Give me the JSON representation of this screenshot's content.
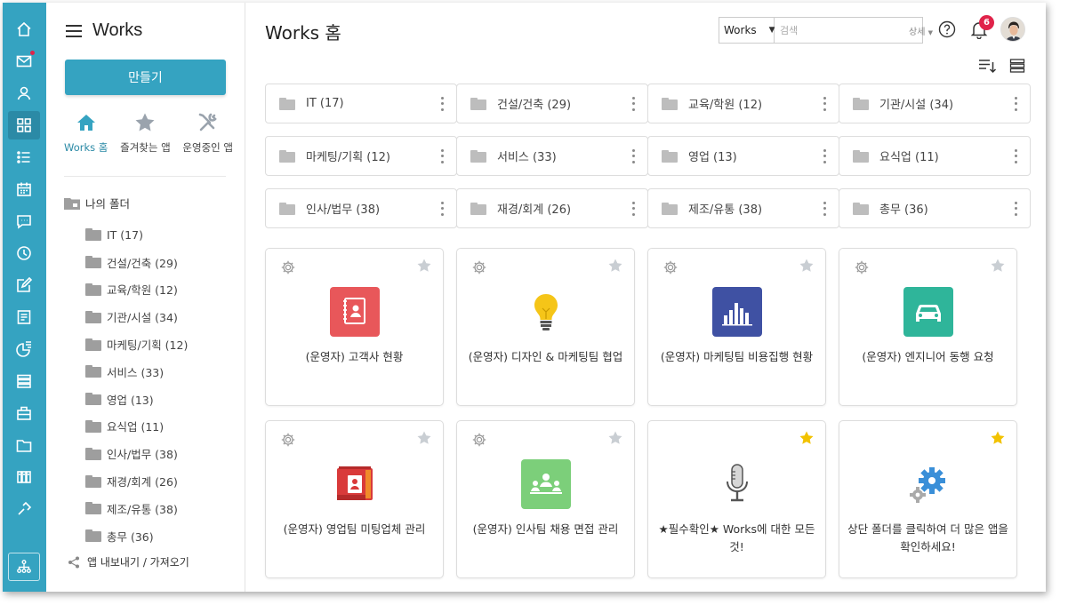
{
  "sidebar": {
    "title": "Works",
    "create_label": "만들기",
    "tabs": [
      {
        "label": "Works 홈",
        "icon": "home-icon"
      },
      {
        "label": "즐겨찾는 앱",
        "icon": "star-icon"
      },
      {
        "label": "운영중인 앱",
        "icon": "tools-icon"
      }
    ],
    "my_folder_label": "나의 폴더",
    "folders": [
      "IT (17)",
      "건설/건축 (29)",
      "교육/학원 (12)",
      "기관/시설 (34)",
      "마케팅/기획 (12)",
      "서비스 (33)",
      "영업 (13)",
      "요식업 (11)",
      "인사/법무 (38)",
      "재경/회계 (26)",
      "제조/유통 (38)",
      "총무 (36)"
    ],
    "export_label": "앱 내보내기 / 가져오기"
  },
  "header": {
    "title": "Works 홈",
    "search_scope": "Works",
    "search_placeholder": "검색",
    "search_detail": "상세",
    "notification_count": "6"
  },
  "folder_cards": [
    "IT (17)",
    "건설/건축 (29)",
    "교육/학원 (12)",
    "기관/시설 (34)",
    "마케팅/기획 (12)",
    "서비스 (33)",
    "영업 (13)",
    "요식업 (11)",
    "인사/법무 (38)",
    "재경/회계 (26)",
    "제조/유통 (38)",
    "총무 (36)"
  ],
  "apps": [
    {
      "label": "(운영자) 고객사 현황",
      "icon": "contact-book-icon",
      "color": "#e8575a",
      "starred": false
    },
    {
      "label": "(운영자) 디자인 & 마케팅팀 협업",
      "icon": "lightbulb-icon",
      "color": "#f5c518",
      "starred": false
    },
    {
      "label": "(운영자) 마케팅팀 비용집행 현황",
      "icon": "bar-chart-icon",
      "color": "#3f51a3",
      "starred": false
    },
    {
      "label": "(운영자) 엔지니어 동행 요청",
      "icon": "car-icon",
      "color": "#2fb59a",
      "starred": false
    },
    {
      "label": "(운영자) 영업팀 미팅업체 관리",
      "icon": "id-card-icon",
      "color": "#d93a3a",
      "starred": false
    },
    {
      "label": "(운영자) 인사팀 채용 면접 관리",
      "icon": "interview-icon",
      "color": "#7ccf7a",
      "starred": false
    },
    {
      "label": "★필수확인★ Works에 대한 모든 것!",
      "icon": "microphone-icon",
      "color": "#555555",
      "starred": true
    },
    {
      "label": "상단 폴더를 클릭하여 더 많은 앱을 확인하세요!",
      "icon": "gears-icon",
      "color": "#3a8fd8",
      "starred": true
    }
  ],
  "colors": {
    "accent": "#35a3c1",
    "badge": "#e0234a",
    "star_active": "#f2c200"
  }
}
